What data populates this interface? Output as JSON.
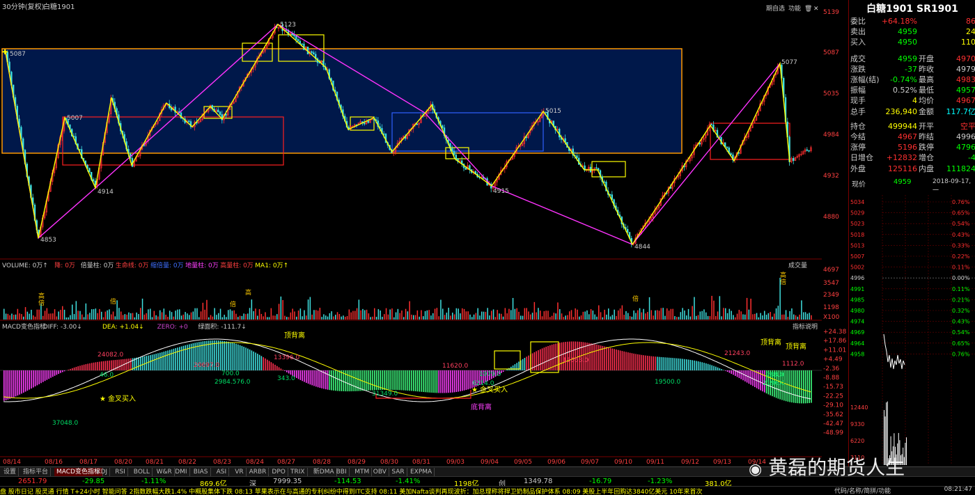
{
  "window": {
    "period": "30分钟(复权)",
    "symbol": "白糖1901",
    "header_buttons": [
      "期自选",
      "功能"
    ]
  },
  "price_axis": [
    "5139",
    "5087",
    "5035",
    "4984",
    "4932",
    "4880"
  ],
  "main_labels": {
    "p5087": "5087",
    "p5123": "5123",
    "p5007": "5007",
    "p4914": "4914",
    "p4853": "4853",
    "p5015": "5015",
    "p4915": "4915",
    "p4844": "4844",
    "p5077": "5077"
  },
  "volume": {
    "header": [
      {
        "t": "VOLUME: 0万↑",
        "c": "#cccccc"
      },
      {
        "t": "降: 0万",
        "c": "#ff4040"
      },
      {
        "t": "倍量柱: 0万",
        "c": "#cccccc"
      },
      {
        "t": "生命线: 0万",
        "c": "#ff4040"
      },
      {
        "t": "缩倍量: 0万",
        "c": "#4070ff"
      },
      {
        "t": "地量柱: 0万",
        "c": "#ff40ff"
      },
      {
        "t": "高量柱: 0万",
        "c": "#ff4040"
      },
      {
        "t": "MA1: 0万↑",
        "c": "#ffff00"
      }
    ],
    "btn": "成交量",
    "axis": [
      "4697",
      "3547",
      "2349",
      "1198",
      "X100"
    ]
  },
  "macd": {
    "header": [
      {
        "t": "MACD变色指标",
        "c": "#cccccc"
      },
      {
        "t": "DIFF: -3.00↓",
        "c": "#cccccc"
      },
      {
        "t": "DEA: +1.04↓",
        "c": "#ffff00"
      },
      {
        "t": "ZERO: +0",
        "c": "#cc44cc"
      },
      {
        "t": "绿面积: -111.7↓",
        "c": "#cccccc"
      }
    ],
    "btn": "指标说明",
    "axis": [
      "+24.38",
      "+17.86",
      "+11.01",
      "+4.49",
      "-2.36",
      "-8.88",
      "-15.73",
      "-22.25",
      "-29.10",
      "-35.62",
      "-42.47",
      "-48.99"
    ],
    "labels": {
      "a24082": "24082.0",
      "a46": "46.0",
      "a20697": "20697.0",
      "a2984": "2984.576.0",
      "a343": "343.0",
      "a13396": "13396.0",
      "a11620": "11620.0",
      "a31349": "31349.0",
      "a6214": "6214.0",
      "a1979": "1979.0",
      "a15053": "15053.0",
      "a19500": "19500.0",
      "a21243": "21243.0",
      "a1112": "1112.0",
      "a2196": "2196.0",
      "a37048": "37048.0",
      "a700": "700.0",
      "a288": "288.0"
    },
    "annotations": {
      "gold1": "金叉买入",
      "gold2": "金叉买入",
      "top1": "顶背离",
      "bottom": "底背离",
      "top2": "顶背离",
      "top3": "顶背离"
    }
  },
  "dates": [
    "08/14",
    "08/16",
    "08/17",
    "08/20",
    "08/21",
    "08/22",
    "08/23",
    "08/24",
    "08/27",
    "08/28",
    "08/29",
    "08/30",
    "08/31",
    "09/03",
    "09/04",
    "09/05",
    "09/06",
    "09/07",
    "09/10",
    "09/11",
    "09/12",
    "09/13",
    "09/14"
  ],
  "quote": {
    "title": "白糖1901 SR1901",
    "rows": [
      {
        "l": "委比",
        "v": "+64.18%",
        "vc": "#ff3030",
        "e": "86",
        "ec": "#ff3030"
      },
      {
        "l": "卖出",
        "v": "4959",
        "vc": "#00ff00",
        "e": "24",
        "ec": "#ffff00"
      },
      {
        "l": "买入",
        "v": "4950",
        "vc": "#00ff00",
        "e": "110",
        "ec": "#ffff00"
      },
      {
        "l": "成交",
        "v": "4959",
        "vc": "#00ff00",
        "l2": "开盘",
        "e": "4970",
        "ec": "#ff3030"
      },
      {
        "l": "涨跌",
        "v": "-37",
        "vc": "#00ff00",
        "l2": "昨收",
        "e": "4979",
        "ec": "#cccccc"
      },
      {
        "l": "涨幅(结)",
        "v": "-0.74%",
        "vc": "#00ff00",
        "l2": "最高",
        "e": "4983",
        "ec": "#ff3030"
      },
      {
        "l": "振幅",
        "v": "0.52%",
        "vc": "#cccccc",
        "l2": "最低",
        "e": "4957",
        "ec": "#00ff00"
      },
      {
        "l": "现手",
        "v": "4",
        "vc": "#ffff00",
        "l2": "均价",
        "e": "4967",
        "ec": "#ff3030"
      },
      {
        "l": "总手",
        "v": "236,940",
        "vc": "#ffff00",
        "l2": "金额",
        "e": "117.7亿",
        "ec": "#00ffff"
      },
      {
        "l": "持仓",
        "v": "499944",
        "vc": "#ffff00",
        "l2": "开平",
        "e": "空平",
        "ec": "#ff3030"
      },
      {
        "l": "今结",
        "v": "4967",
        "vc": "#ff3030",
        "l2": "昨结",
        "e": "4996",
        "ec": "#cccccc"
      },
      {
        "l": "涨停",
        "v": "5196",
        "vc": "#ff3030",
        "l2": "跌停",
        "e": "4796",
        "ec": "#00ff00"
      },
      {
        "l": "日增仓",
        "v": "+12832",
        "vc": "#ff3030",
        "l2": "增仓",
        "e": "-4",
        "ec": "#00ff00"
      },
      {
        "l": "外盘",
        "v": "125116",
        "vc": "#ff3030",
        "l2": "内盘",
        "e": "111824",
        "ec": "#00ff00"
      }
    ],
    "price_label": "现价",
    "price": "4959",
    "date": "2018-09-17,一"
  },
  "mini": {
    "prices": [
      "5034",
      "5029",
      "5023",
      "5018",
      "5013",
      "5007",
      "5002",
      "4996",
      "4991",
      "4985",
      "4980",
      "4974",
      "4969",
      "4964",
      "4958"
    ],
    "pcts": [
      "0.76%",
      "0.65%",
      "0.54%",
      "0.43%",
      "0.33%",
      "0.22%",
      "0.11%",
      "0.00%",
      "0.11%",
      "0.21%",
      "0.32%",
      "0.43%",
      "0.54%",
      "0.65%",
      "0.76%"
    ],
    "vol": [
      "12440",
      "9330",
      "6220",
      "3110"
    ]
  },
  "tabs": [
    "设置",
    "指标平台",
    "MACD变色指标",
    "KDJ",
    "RSI",
    "BOLL",
    "W&R",
    "DMI",
    "BIAS",
    "ASI",
    "VR",
    "ARBR",
    "DPO",
    "TRIX",
    "新DMA",
    "BBI",
    "MTM",
    "OBV",
    "SAR",
    "EXPMA"
  ],
  "status": [
    {
      "t": "2651.79",
      "c": "#ff3030"
    },
    {
      "t": "-29.85",
      "c": "#00ff00"
    },
    {
      "t": "-1.11%",
      "c": "#00ff00"
    },
    {
      "t": "869.6亿",
      "c": "#ffff00"
    },
    {
      "t": "深",
      "c": "#cccccc"
    },
    {
      "t": "7999.35",
      "c": "#cccccc"
    },
    {
      "t": "-114.53",
      "c": "#00ff00"
    },
    {
      "t": "-1.41%",
      "c": "#00ff00"
    },
    {
      "t": "1198亿",
      "c": "#ffff00"
    },
    {
      "t": "创",
      "c": "#cccccc"
    },
    {
      "t": "1349.78",
      "c": "#cccccc"
    },
    {
      "t": "-16.79",
      "c": "#00ff00"
    },
    {
      "t": "-1.23%",
      "c": "#00ff00"
    },
    {
      "t": "381.0亿",
      "c": "#ffff00"
    }
  ],
  "ticker": "盘  股市日记  股灵通  行情  T+24小时  智能问答   2指数跌幅大跌1.4% 中概股集体下跌     08:13 苹果表示在与高通的专利纠纷中得到ITC支持     08:11 美加Nafta谈判再现波折：加总理称将捍卫奶制品保护体系     08:09 美股上半年回购达3840亿美元 10年来首次",
  "watermark": "黄磊的期货人生",
  "clock": "08:21:47",
  "bottom_right": "代码/名称/简拼/功能"
}
